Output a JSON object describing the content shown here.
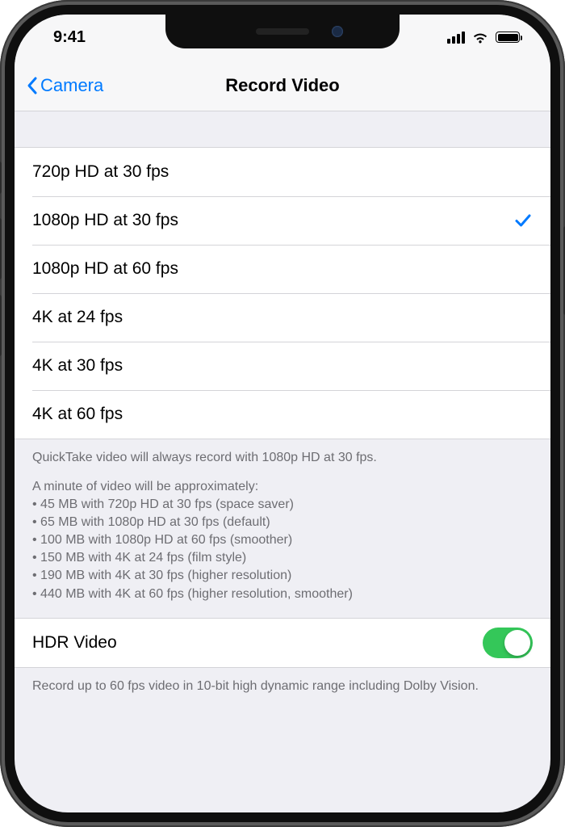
{
  "status": {
    "time": "9:41"
  },
  "nav": {
    "back_label": "Camera",
    "title": "Record Video"
  },
  "options": [
    {
      "label": "720p HD at 30 fps",
      "selected": false
    },
    {
      "label": "1080p HD at 30 fps",
      "selected": true
    },
    {
      "label": "1080p HD at 60 fps",
      "selected": false
    },
    {
      "label": "4K at 24 fps",
      "selected": false
    },
    {
      "label": "4K at 30 fps",
      "selected": false
    },
    {
      "label": "4K at 60 fps",
      "selected": false
    }
  ],
  "info": {
    "quicktake": "QuickTake video will always record with 1080p HD at 30 fps.",
    "approx_intro": "A minute of video will be approximately:",
    "lines": [
      "45 MB with 720p HD at 30 fps (space saver)",
      "65 MB with 1080p HD at 30 fps (default)",
      "100 MB with 1080p HD at 60 fps (smoother)",
      "150 MB with 4K at 24 fps (film style)",
      "190 MB with 4K at 30 fps (higher resolution)",
      "440 MB with 4K at 60 fps (higher resolution, smoother)"
    ]
  },
  "hdr": {
    "label": "HDR Video",
    "enabled": true,
    "footer": "Record up to 60 fps video in 10-bit high dynamic range including Dolby Vision."
  }
}
